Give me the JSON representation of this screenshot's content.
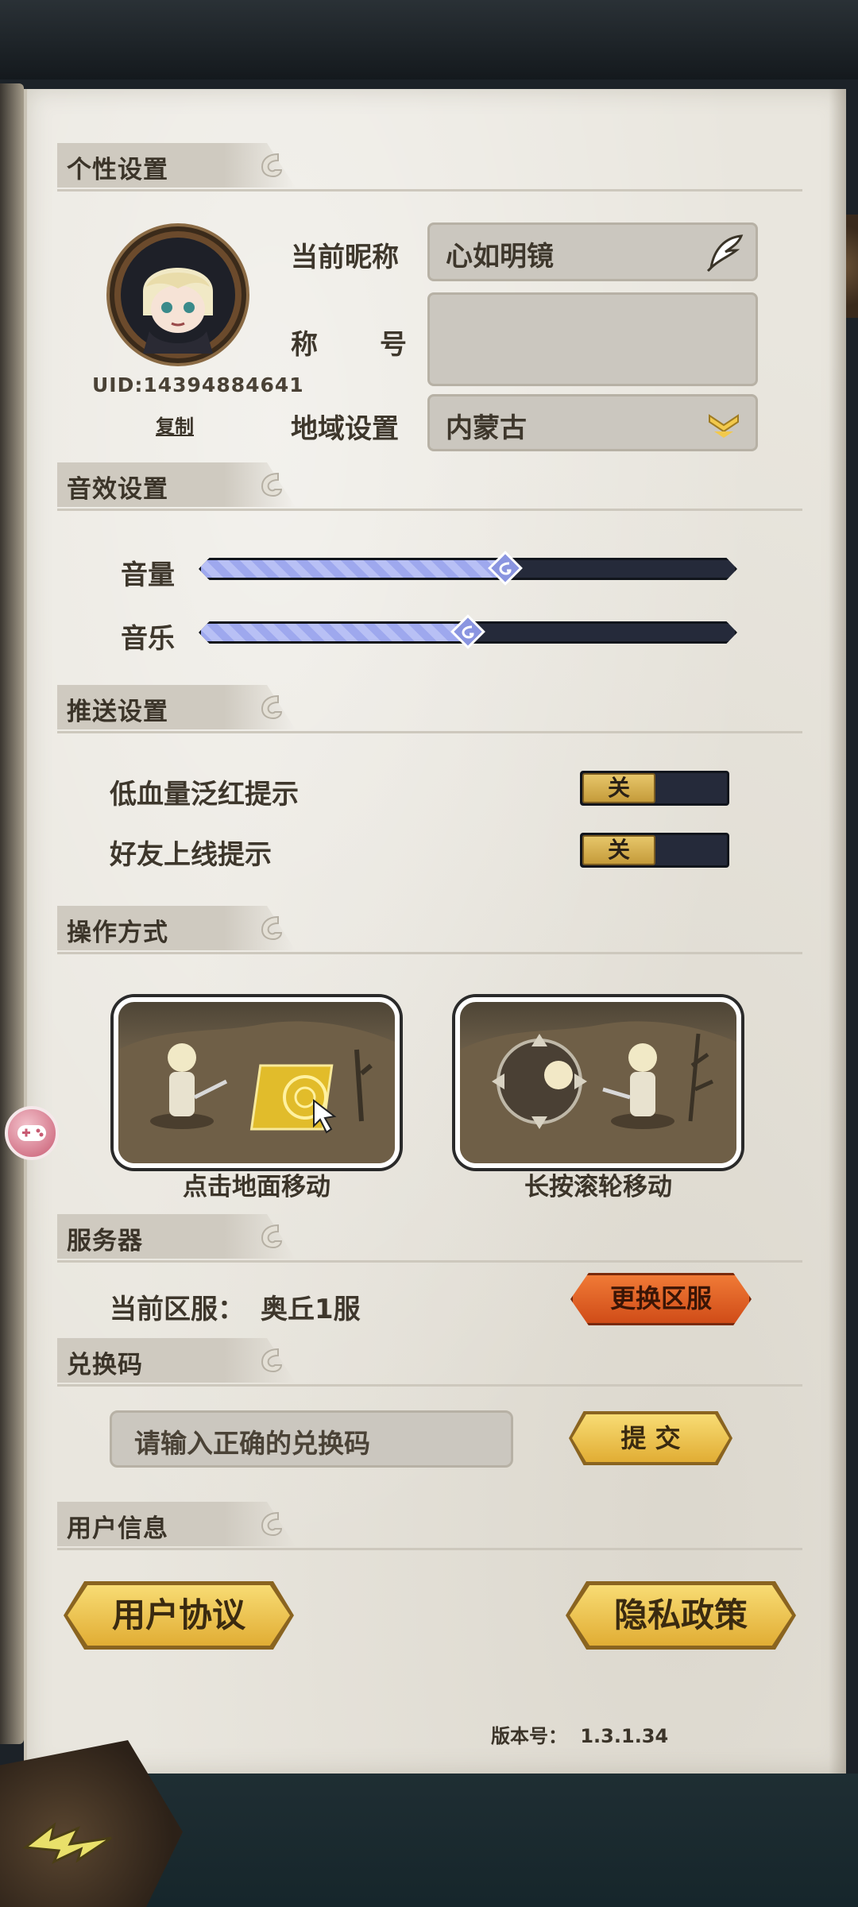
{
  "sections": {
    "personal": "个性设置",
    "sound": "音效设置",
    "push": "推送设置",
    "operation": "操作方式",
    "server": "服务器",
    "redeem": "兑换码",
    "user_info": "用户信息"
  },
  "profile": {
    "uid": "UID:14394884641",
    "copy_label": "复制",
    "nickname_label": "当前昵称",
    "nickname_value": "心如明镜",
    "title_label_1": "称",
    "title_label_2": "号",
    "title_value": "",
    "region_label": "地域设置",
    "region_value": "内蒙古"
  },
  "sound": {
    "volume_label": "音量",
    "volume_level": 0.57,
    "music_label": "音乐",
    "music_level": 0.5
  },
  "push": {
    "low_hp_label": "低血量泛红提示",
    "low_hp_state": "关",
    "friend_online_label": "好友上线提示",
    "friend_online_state": "关"
  },
  "operation": {
    "tap_label": "点击地面移动",
    "wheel_label": "长按滚轮移动"
  },
  "server": {
    "current_label": "当前区服：",
    "current_value": "奥丘1服",
    "change_button": "更换区服"
  },
  "redeem": {
    "placeholder": "请输入正确的兑换码",
    "submit_button": "提 交"
  },
  "user_info": {
    "agreement_button": "用户协议",
    "privacy_button": "隐私政策"
  },
  "version": {
    "label": "版本号：",
    "value": "1.3.1.34"
  },
  "colors": {
    "paper": "#e9e6de",
    "slider_fill": "#9ea8ee",
    "toggle_gold": "#d9b24e",
    "orange_button": "#e4612a",
    "gold_button": "#f0c650"
  },
  "icons": {
    "edit": "feather-quill-icon",
    "dropdown": "chevron-down-icon",
    "back": "lightning-arrow-icon",
    "float": "gamepad-icon"
  }
}
